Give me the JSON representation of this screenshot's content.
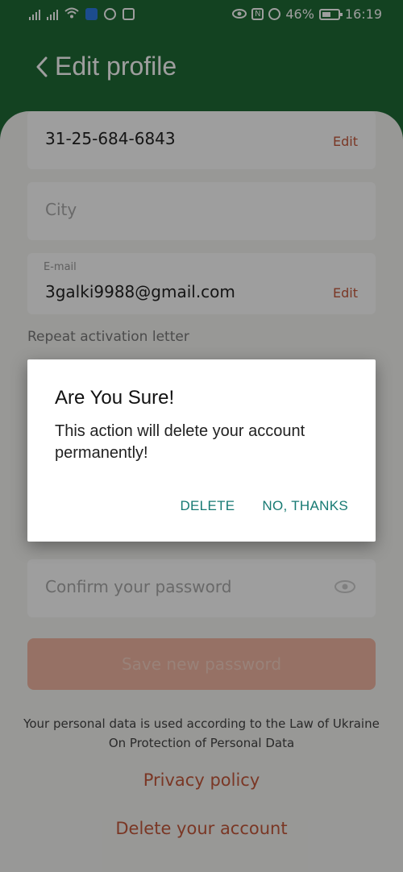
{
  "status_bar": {
    "battery": "46%",
    "time": "16:19"
  },
  "header": {
    "title": "Edit profile"
  },
  "form": {
    "phone_value": "31-25-684-6843",
    "phone_edit": "Edit",
    "city_placeholder": "City",
    "email_label": "E-mail",
    "email_value": "3galki9988@gmail.com",
    "email_edit": "Edit",
    "repeat_activation": "Repeat activation letter",
    "confirm_password_placeholder": "Confirm your password",
    "save_button": "Save new password"
  },
  "footer": {
    "legal_text": "Your personal data is used according to the Law of Ukraine On Protection of Personal Data",
    "privacy_link": "Privacy policy",
    "delete_link": "Delete your account"
  },
  "dialog": {
    "title": "Are You Sure!",
    "message": "This action will delete your account permanently!",
    "delete_button": "DELETE",
    "cancel_button": "NO, THANKS"
  },
  "colors": {
    "header_green": "#1f6b36",
    "accent_orange": "#c65a3c",
    "dialog_action_teal": "#177a73"
  }
}
